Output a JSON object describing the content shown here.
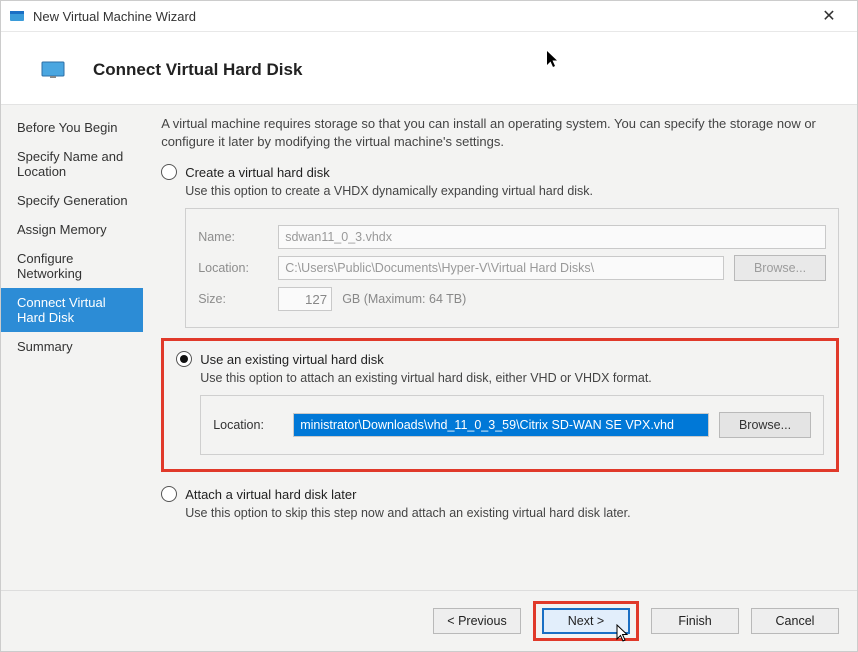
{
  "window": {
    "title": "New Virtual Machine Wizard"
  },
  "header": {
    "page_title": "Connect Virtual Hard Disk"
  },
  "sidebar": {
    "items": [
      {
        "label": "Before You Begin"
      },
      {
        "label": "Specify Name and Location"
      },
      {
        "label": "Specify Generation"
      },
      {
        "label": "Assign Memory"
      },
      {
        "label": "Configure Networking"
      },
      {
        "label": "Connect Virtual Hard Disk"
      },
      {
        "label": "Summary"
      }
    ],
    "selected_index": 5
  },
  "content": {
    "intro": "A virtual machine requires storage so that you can install an operating system. You can specify the storage now or configure it later by modifying the virtual machine's settings.",
    "option_create": {
      "label": "Create a virtual hard disk",
      "desc": "Use this option to create a VHDX dynamically expanding virtual hard disk.",
      "name_label": "Name:",
      "name_value": "sdwan11_0_3.vhdx",
      "location_label": "Location:",
      "location_value": "C:\\Users\\Public\\Documents\\Hyper-V\\Virtual Hard Disks\\",
      "size_label": "Size:",
      "size_value": "127",
      "gb_label": "GB (Maximum: 64 TB)",
      "browse_label": "Browse..."
    },
    "option_existing": {
      "label": "Use an existing virtual hard disk",
      "desc": "Use this option to attach an existing virtual hard disk, either VHD or VHDX format.",
      "location_label": "Location:",
      "location_value": "ministrator\\Downloads\\vhd_11_0_3_59\\Citrix SD-WAN SE VPX.vhd",
      "browse_label": "Browse..."
    },
    "option_later": {
      "label": "Attach a virtual hard disk later",
      "desc": "Use this option to skip this step now and attach an existing virtual hard disk later."
    },
    "selected_option": "existing"
  },
  "footer": {
    "previous": "< Previous",
    "next": "Next >",
    "finish": "Finish",
    "cancel": "Cancel"
  }
}
